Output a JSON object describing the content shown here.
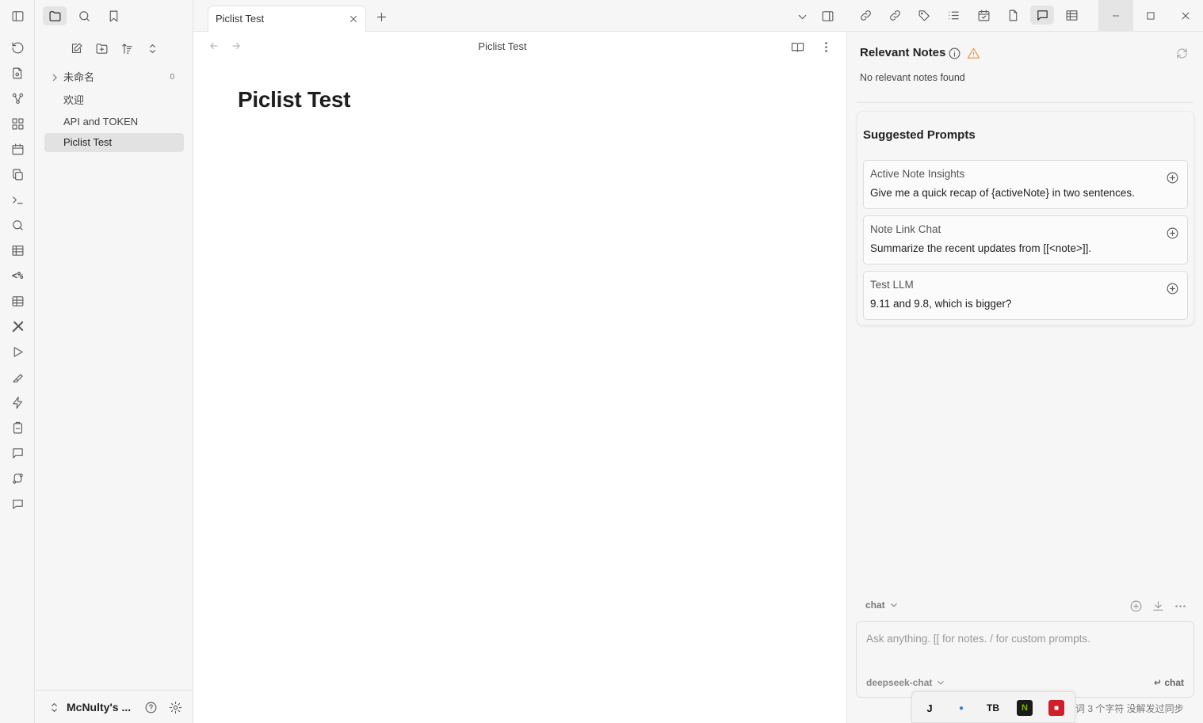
{
  "colors": {
    "accent": "#7b6cd9",
    "warning": "#e8903a",
    "muted": "#888888",
    "active_bg": "#e2e2e2"
  },
  "ribbon": {
    "icons": [
      "sidebar-toggle-icon",
      "sync-icon",
      "import-icon",
      "graph-icon",
      "canvas-icon",
      "calendar-icon",
      "copy-icon",
      "terminal-icon",
      "search-icon",
      "table-icon",
      "templater-icon",
      "grid-icon",
      "tools-icon",
      "play-icon",
      "highlighter-icon",
      "lightning-icon",
      "clipboard-icon",
      "chat-icon",
      "branch-icon",
      "message-icon"
    ]
  },
  "file_explorer": {
    "items": [
      {
        "label": "未命名",
        "count": "0",
        "type": "folder"
      },
      {
        "label": "欢迎",
        "type": "file"
      },
      {
        "label": "API and TOKEN",
        "type": "file"
      },
      {
        "label": "Piclist Test",
        "type": "file",
        "active": true
      }
    ],
    "vault_name": "McNulty's ..."
  },
  "tabs": [
    {
      "label": "Piclist Test",
      "active": true
    }
  ],
  "view": {
    "breadcrumb": "Piclist Test",
    "title": "Piclist Test"
  },
  "copilot": {
    "relevant_title": "Relevant Notes",
    "relevant_empty": "No relevant notes found",
    "suggested_title": "Suggested Prompts",
    "prompts": [
      {
        "title": "Active Note Insights",
        "text": "Give me a quick recap of {activeNote} in two sentences."
      },
      {
        "title": "Note Link Chat",
        "text": "Summarize the recent updates from [[<note>]]."
      },
      {
        "title": "Test LLM",
        "text": "9.11 and 9.8, which is bigger?"
      }
    ],
    "mode": "chat",
    "input_placeholder": "Ask anything. [[ for notes. / for custom prompts.",
    "model": "deepseek-chat",
    "send_label": "↵ chat"
  },
  "taskbar": {
    "apps": [
      "J",
      "●",
      "TB",
      "N",
      "■"
    ]
  },
  "status": {
    "text": "词  3 个字符   没解发过同步"
  }
}
